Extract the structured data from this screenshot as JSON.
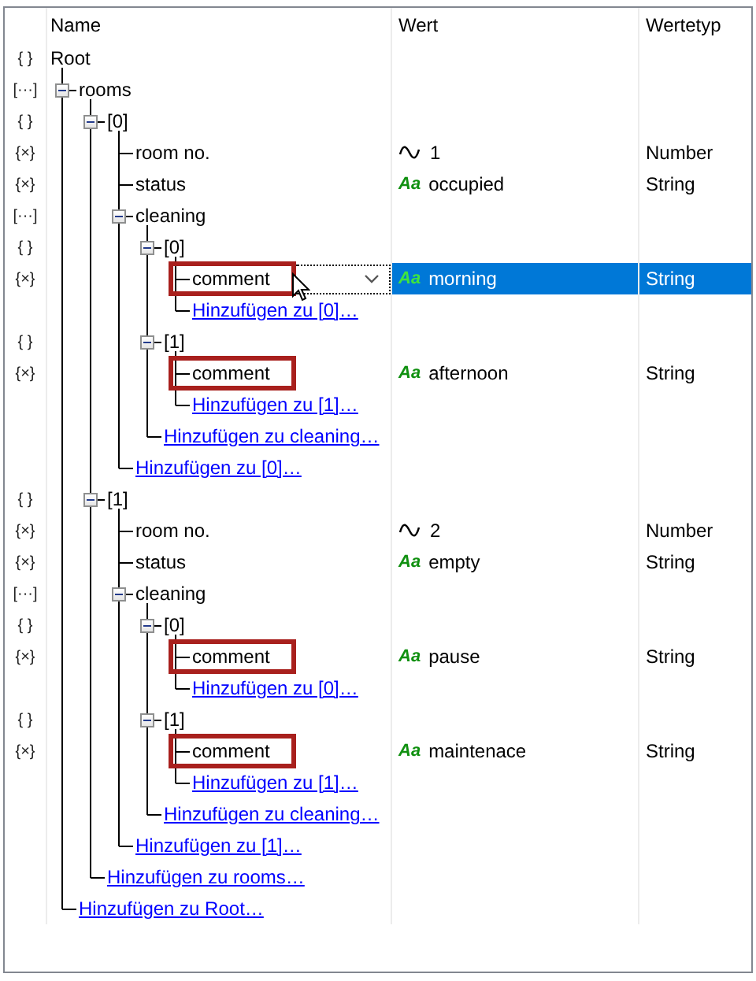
{
  "columns": [
    "Name",
    "Wert",
    "Wertetyp"
  ],
  "root": {
    "marker": "{ }",
    "label": "Root",
    "children": [
      {
        "marker": "[···]",
        "label": "rooms",
        "expanded": true,
        "children": [
          {
            "marker": "{ }",
            "label": "[0]",
            "expanded": true,
            "children": [
              {
                "kind": "number",
                "marker": "{×}",
                "label": "room no.",
                "value": "1",
                "value_type": "Number",
                "selected": false,
                "highlighted": false
              },
              {
                "kind": "string",
                "marker": "{×}",
                "label": "status",
                "glyph": "Aa",
                "value": "occupied",
                "value_type": "String",
                "selected": false,
                "highlighted": false
              },
              {
                "marker": "[···]",
                "label": "cleaning",
                "expanded": true,
                "children": [
                  {
                    "marker": "{ }",
                    "label": "[0]",
                    "expanded": true,
                    "children": [
                      {
                        "kind": "string",
                        "marker": "{×}",
                        "label": "comment",
                        "glyph": "Aa",
                        "value": "morning",
                        "value_type": "String",
                        "selected": true,
                        "highlighted": true
                      },
                      {
                        "kind": "add",
                        "label": "Hinzufügen zu [0]…"
                      }
                    ]
                  },
                  {
                    "marker": "{ }",
                    "label": "[1]",
                    "expanded": true,
                    "children": [
                      {
                        "kind": "string",
                        "marker": "{×}",
                        "label": "comment",
                        "glyph": "Aa",
                        "value": "afternoon",
                        "value_type": "String",
                        "selected": false,
                        "highlighted": true
                      },
                      {
                        "kind": "add",
                        "label": "Hinzufügen zu [1]…"
                      }
                    ]
                  },
                  {
                    "kind": "add",
                    "label": "Hinzufügen zu cleaning…"
                  }
                ]
              },
              {
                "kind": "add",
                "label": "Hinzufügen zu [0]…"
              }
            ]
          },
          {
            "marker": "{ }",
            "label": "[1]",
            "expanded": true,
            "children": [
              {
                "kind": "number",
                "marker": "{×}",
                "label": "room no.",
                "value": "2",
                "value_type": "Number",
                "selected": false,
                "highlighted": false
              },
              {
                "kind": "string",
                "marker": "{×}",
                "label": "status",
                "glyph": "Aa",
                "value": "empty",
                "value_type": "String",
                "selected": false,
                "highlighted": false
              },
              {
                "marker": "[···]",
                "label": "cleaning",
                "expanded": true,
                "children": [
                  {
                    "marker": "{ }",
                    "label": "[0]",
                    "expanded": true,
                    "children": [
                      {
                        "kind": "string",
                        "marker": "{×}",
                        "label": "comment",
                        "glyph": "Aa",
                        "value": "pause",
                        "value_type": "String",
                        "selected": false,
                        "highlighted": true
                      },
                      {
                        "kind": "add",
                        "label": "Hinzufügen zu [0]…"
                      }
                    ]
                  },
                  {
                    "marker": "{ }",
                    "label": "[1]",
                    "expanded": true,
                    "children": [
                      {
                        "kind": "string",
                        "marker": "{×}",
                        "label": "comment",
                        "glyph": "Aa",
                        "value": "maintenace",
                        "value_type": "String",
                        "selected": false,
                        "highlighted": true
                      },
                      {
                        "kind": "add",
                        "label": "Hinzufügen zu [1]…"
                      }
                    ]
                  },
                  {
                    "kind": "add",
                    "label": "Hinzufügen zu cleaning…"
                  }
                ]
              },
              {
                "kind": "add",
                "label": "Hinzufügen zu [1]…"
              }
            ]
          },
          {
            "kind": "add",
            "label": "Hinzufügen zu rooms…"
          }
        ]
      },
      {
        "kind": "add",
        "label": "Hinzufügen zu Root…"
      }
    ]
  }
}
